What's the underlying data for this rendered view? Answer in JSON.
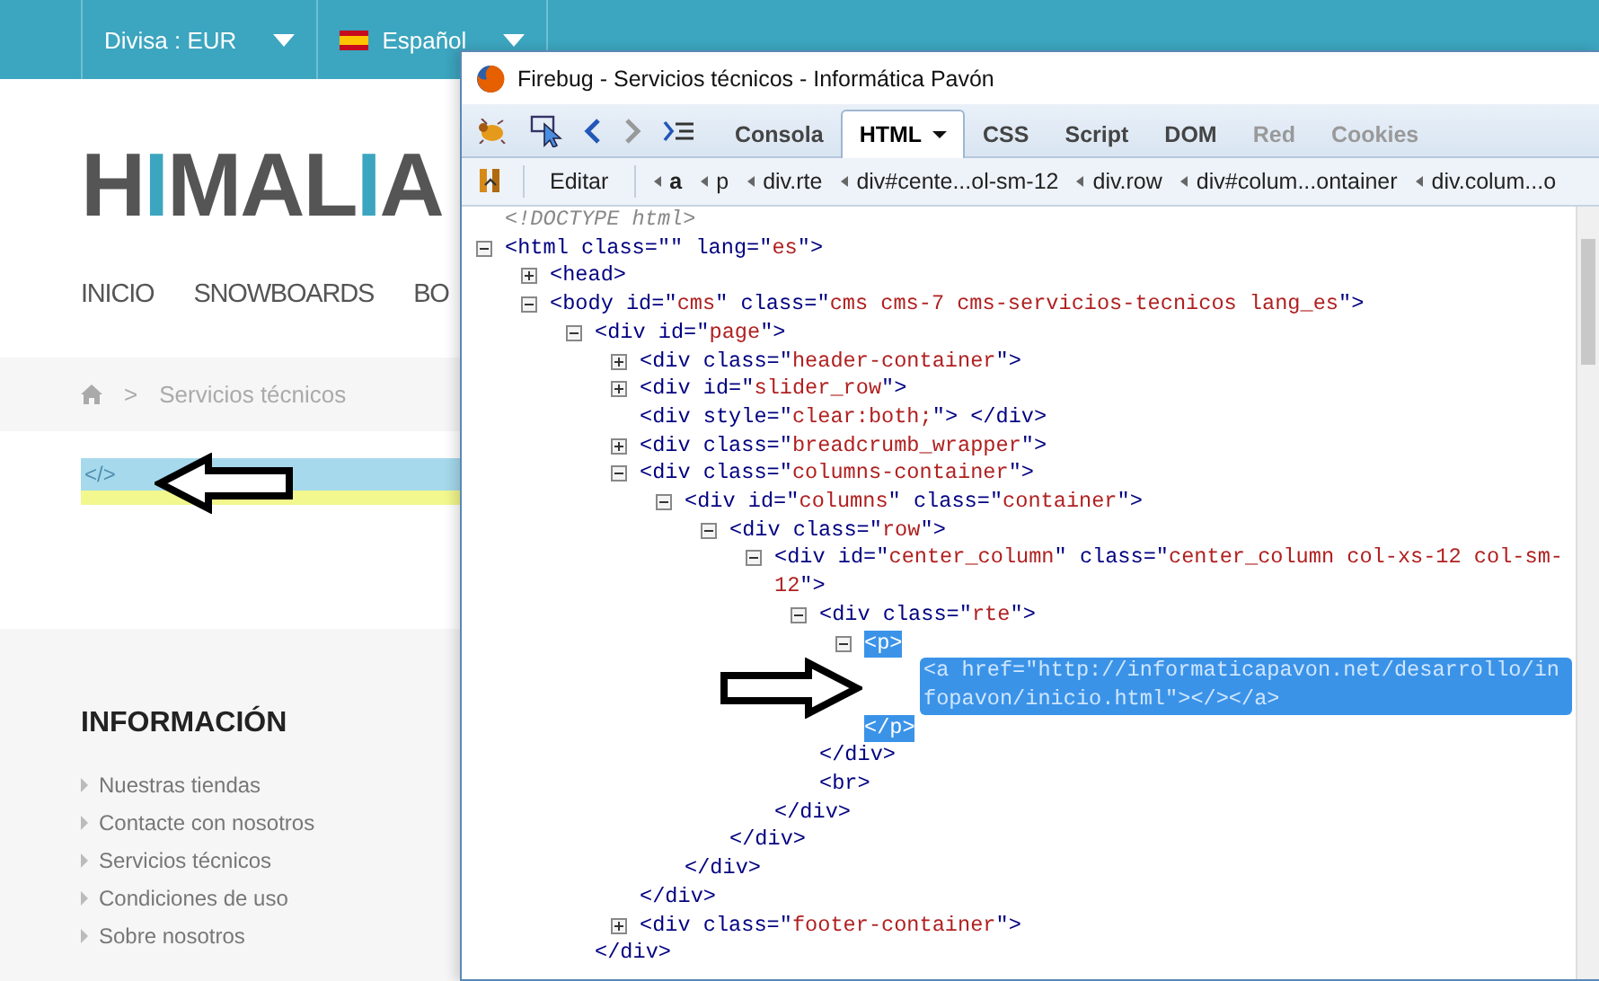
{
  "site": {
    "currency": "Divisa : EUR",
    "language": "Español",
    "logo": [
      {
        "text": "H",
        "accent": false
      },
      {
        "text": "I",
        "accent": true
      },
      {
        "text": "MAL",
        "accent": false
      },
      {
        "text": "I",
        "accent": true
      },
      {
        "text": "A",
        "accent": false
      }
    ],
    "nav": [
      "INICIO",
      "SNOWBOARDS",
      "BO"
    ],
    "breadcrumb_separator": ">",
    "breadcrumb": "Servicios técnicos",
    "selected_element": "</>",
    "footer": {
      "title": "INFORMACIÓN",
      "links": [
        "Nuestras tiendas",
        "Contacte con nosotros",
        "Servicios técnicos",
        "Condiciones de uso",
        "Sobre nosotros"
      ]
    }
  },
  "firebug": {
    "title": "Firebug - Servicios técnicos - Informática Pavón",
    "tabs": [
      {
        "label": "Consola",
        "selected": false,
        "disabled": false,
        "dropdown": false
      },
      {
        "label": "HTML",
        "selected": true,
        "disabled": false,
        "dropdown": true
      },
      {
        "label": "CSS",
        "selected": false,
        "disabled": false,
        "dropdown": false
      },
      {
        "label": "Script",
        "selected": false,
        "disabled": false,
        "dropdown": false
      },
      {
        "label": "DOM",
        "selected": false,
        "disabled": false,
        "dropdown": false
      },
      {
        "label": "Red",
        "selected": false,
        "disabled": true,
        "dropdown": false
      },
      {
        "label": "Cookies",
        "selected": false,
        "disabled": true,
        "dropdown": false
      }
    ],
    "edit_button": "Editar",
    "path": [
      {
        "label": "a",
        "selected": true
      },
      {
        "label": "p",
        "selected": false
      },
      {
        "label": "div.rte",
        "selected": false
      },
      {
        "label": "div#cente...ol-sm-12",
        "selected": false
      },
      {
        "label": "div.row",
        "selected": false
      },
      {
        "label": "div#colum...ontainer",
        "selected": false
      },
      {
        "label": "div.colum...o",
        "selected": false
      }
    ],
    "dom_tree": [
      {
        "kind": "comment",
        "text": "<!DOCTYPE html>",
        "selected": false
      },
      {
        "kind": "parent",
        "text": "<html class=\"\" lang=\"es\">",
        "expanded": true,
        "selected": false,
        "children": [
          {
            "kind": "parent",
            "text": "<head>",
            "expanded": false,
            "selected": false
          },
          {
            "kind": "parent",
            "text": "<body id=\"cms\" class=\"cms cms-7 cms-servicios-tecnicos lang_es\">",
            "expanded": true,
            "selected": false,
            "children": [
              {
                "kind": "parent",
                "text": "<div id=\"page\">",
                "expanded": true,
                "selected": false,
                "children": [
                  {
                    "kind": "parent",
                    "text": "<div class=\"header-container\">",
                    "expanded": false,
                    "selected": false
                  },
                  {
                    "kind": "parent",
                    "text": "<div id=\"slider_row\">",
                    "expanded": false,
                    "selected": false
                  },
                  {
                    "kind": "leaf",
                    "text": "<div style=\"clear:both;\"> </div>",
                    "selected": false
                  },
                  {
                    "kind": "parent",
                    "text": "<div class=\"breadcrumb_wrapper\">",
                    "expanded": false,
                    "selected": false
                  },
                  {
                    "kind": "parent",
                    "text": "<div class=\"columns-container\">",
                    "expanded": true,
                    "selected": false,
                    "closing": "</div>",
                    "children": [
                      {
                        "kind": "parent",
                        "text": "<div id=\"columns\" class=\"container\">",
                        "expanded": true,
                        "selected": false,
                        "closing": "</div>",
                        "children": [
                          {
                            "kind": "parent",
                            "text": "<div class=\"row\">",
                            "expanded": true,
                            "selected": false,
                            "closing": "</div>",
                            "children": [
                              {
                                "kind": "parent",
                                "text": "<div id=\"center_column\" class=\"center_column col-xs-12 col-sm-12\">",
                                "expanded": true,
                                "selected": false,
                                "closing": "</div>",
                                "children": [
                                  {
                                    "kind": "parent",
                                    "text": "<div class=\"rte\">",
                                    "expanded": true,
                                    "selected": false,
                                    "closing": "</div>",
                                    "children": [
                                      {
                                        "kind": "parent",
                                        "text": "<p>",
                                        "expanded": true,
                                        "selected": true,
                                        "closing": "</p>",
                                        "children": [
                                          {
                                            "kind": "leaf",
                                            "text": "<a href=\"http://informaticapavon.net/desarrollo/infopavon/inicio.html\"></></a>",
                                            "selected": true
                                          }
                                        ]
                                      }
                                    ]
                                  },
                                  {
                                    "kind": "leaf",
                                    "text": "<br>",
                                    "selected": false
                                  }
                                ]
                              }
                            ]
                          }
                        ]
                      }
                    ]
                  },
                  {
                    "kind": "parent",
                    "text": "<div class=\"footer-container\">",
                    "expanded": false,
                    "selected": false
                  }
                ],
                "closing": "</div>"
              }
            ]
          }
        ]
      }
    ]
  }
}
